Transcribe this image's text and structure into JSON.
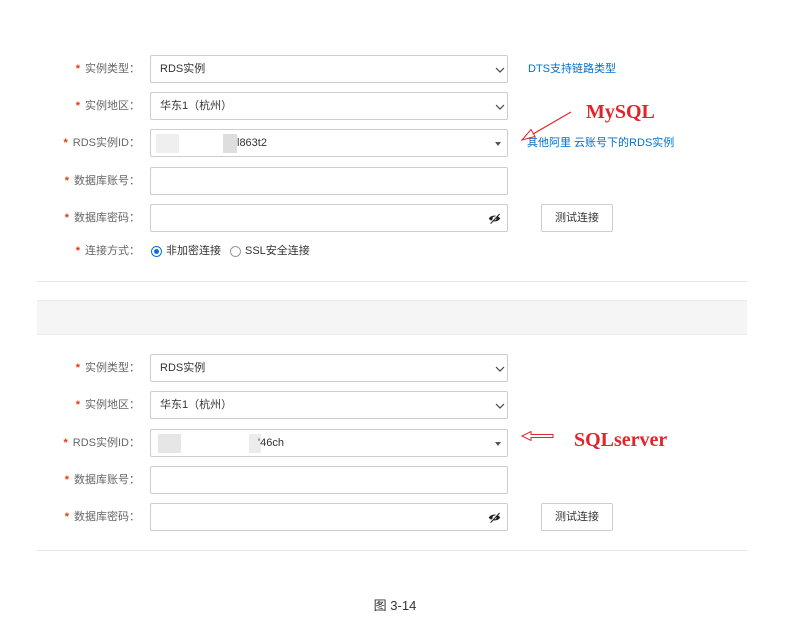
{
  "required_mark": "*",
  "source": {
    "instance_type": {
      "label": "实例类型：",
      "value": "RDS实例"
    },
    "region": {
      "label": "实例地区：",
      "value": "华东1（杭州）"
    },
    "instance_id": {
      "label": "RDS实例ID：",
      "value": "l863t2"
    },
    "db_account": {
      "label": "数据库账号："
    },
    "db_password": {
      "label": "数据库密码："
    },
    "connection": {
      "label": "连接方式：",
      "options": [
        "非加密连接",
        "SSL安全连接"
      ],
      "selected": "非加密连接"
    },
    "test_button": "测试连接",
    "link_supported_types": "DTS支持链路类型",
    "link_other_account": "其他阿里 云账号下的RDS实例"
  },
  "target": {
    "instance_type": {
      "label": "实例类型：",
      "value": "RDS实例"
    },
    "region": {
      "label": "实例地区：",
      "value": "华东1（杭州）"
    },
    "instance_id": {
      "label": "RDS实例ID：",
      "value": "'46ch"
    },
    "db_account": {
      "label": "数据库账号："
    },
    "db_password": {
      "label": "数据库密码："
    },
    "test_button": "测试连接"
  },
  "annotations": {
    "source_engine": "MySQL",
    "target_engine": "SQLserver"
  },
  "caption": "图 3-14",
  "icons": {
    "select_chevron": "chevron-down-icon",
    "instance_id_dropdown": "caret-down-icon",
    "password_visibility": "eye-off-icon",
    "annotation_arrow": "arrow-icon"
  },
  "colors": {
    "link": "#0070cc",
    "required": "#e8380d",
    "annotation": "#e0262b",
    "radio_checked": "#0a6fd8"
  }
}
